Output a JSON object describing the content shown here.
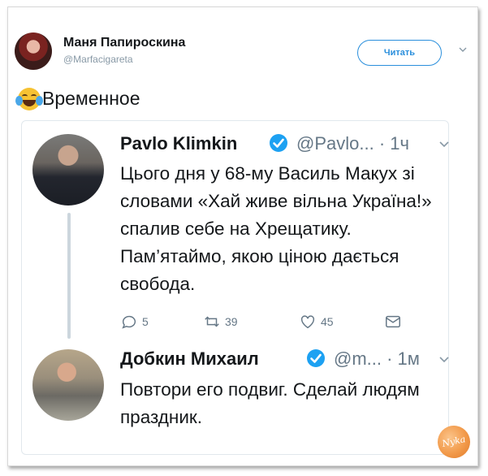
{
  "tweet": {
    "author_name": "Маня Папироскина",
    "author_handle": "@Marfacigareta",
    "follow_label": "Читать",
    "text": "Временное",
    "emoji_icon": "joy-emoji-icon"
  },
  "quoted": {
    "name": "Pavlo Klimkin",
    "handle": "@Pavlo... · 1ч",
    "text": "Цього дня у 68-му Василь Макух зі словами «Хай живе вільна Україна!» спалив себе на Хрещатику. Пам’ятаймо, якою ціною дається свобода.",
    "replies": "5",
    "retweets": "39",
    "likes": "45"
  },
  "reply": {
    "name": "Добкин Михаил",
    "handle": "@m... · 1м",
    "text": "Повтори его подвиг. Сделай людям праздник."
  },
  "watermark": {
    "text": "Nyka"
  },
  "colors": {
    "accent": "#2a8fdc",
    "verified": "#1da1f2",
    "muted": "#657786"
  }
}
